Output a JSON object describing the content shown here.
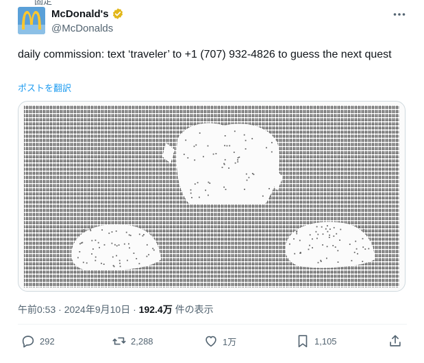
{
  "pinned_label": "固定",
  "author": {
    "name": "McDonald's",
    "handle": "@McDonalds"
  },
  "tweet": {
    "text": "daily commission: text ‘traveler’ to +1 (707) 932-4826 to guess the next quest",
    "translate_label": "ポストを翻訳"
  },
  "meta": {
    "time": "午前0:53",
    "sep1": " · ",
    "date": "2024年9月10日",
    "sep2": " · ",
    "views": "192.4万",
    "views_label": " 件の表示"
  },
  "actions": {
    "replies": "292",
    "reposts": "2,288",
    "likes": "1万",
    "bookmarks": "1,105"
  },
  "icons": [
    "arches-logo-avatar",
    "verified-badge-icon",
    "more-icon",
    "reply-icon",
    "repost-icon",
    "like-icon",
    "bookmark-icon",
    "share-icon"
  ],
  "colors": {
    "accent": "#1d9bf0",
    "verified": "#e2b719",
    "avatar_bg": "#5aa0d8",
    "logo": "#ffc72c",
    "text": "#0f1419",
    "muted": "#536471"
  }
}
